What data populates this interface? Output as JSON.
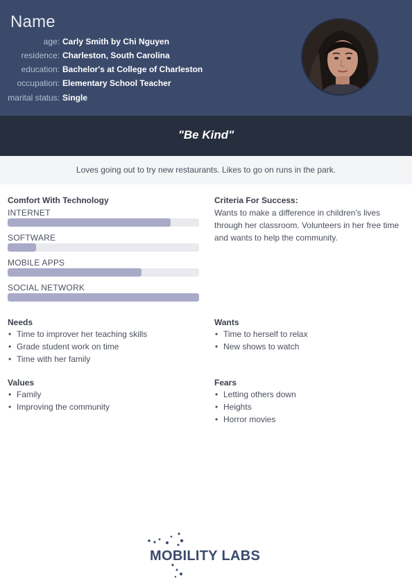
{
  "header": {
    "title": "Name",
    "fields": [
      {
        "key": "age:",
        "value": "Carly Smith by Chi Nguyen"
      },
      {
        "key": "residence:",
        "value": "Charleston, South Carolina"
      },
      {
        "key": "education:",
        "value": "Bachelor's at College of Charleston"
      },
      {
        "key": "occupation:",
        "value": "Elementary School Teacher"
      },
      {
        "key": "marital status:",
        "value": "Single"
      }
    ]
  },
  "quote": "\"Be Kind\"",
  "bio": "Loves going out to try new restaurants. Likes to go on runs in the park.",
  "comfort": {
    "title": "Comfort With Technology",
    "items": [
      {
        "label": "INTERNET",
        "level": 0.85
      },
      {
        "label": "SOFTWARE",
        "level": 0.15
      },
      {
        "label": "MOBILE APPS",
        "level": 0.7
      },
      {
        "label": "SOCIAL NETWORK",
        "level": 1.0
      }
    ]
  },
  "criteria": {
    "title": "Criteria For Success:",
    "text": "Wants to make a difference in children's lives through her classroom. Volunteers in her free time and wants to help the community."
  },
  "needs": {
    "title": "Needs",
    "items": [
      "Time to improver her teaching skills",
      "Grade student work on time",
      "Time with her family"
    ]
  },
  "wants": {
    "title": "Wants",
    "items": [
      "Time to herself to relax",
      "New shows to watch"
    ]
  },
  "values": {
    "title": "Values",
    "items": [
      "Family",
      "Improving the community"
    ]
  },
  "fears": {
    "title": "Fears",
    "items": [
      "Letting others down",
      "Heights",
      "Horror movies"
    ]
  },
  "logo": {
    "text": "MOBILITY LABS"
  },
  "colors": {
    "header": "#3b4a6b",
    "quote_band": "#272e3d",
    "bar_fill": "#a9aac8",
    "bar_track": "#e9eaee"
  }
}
